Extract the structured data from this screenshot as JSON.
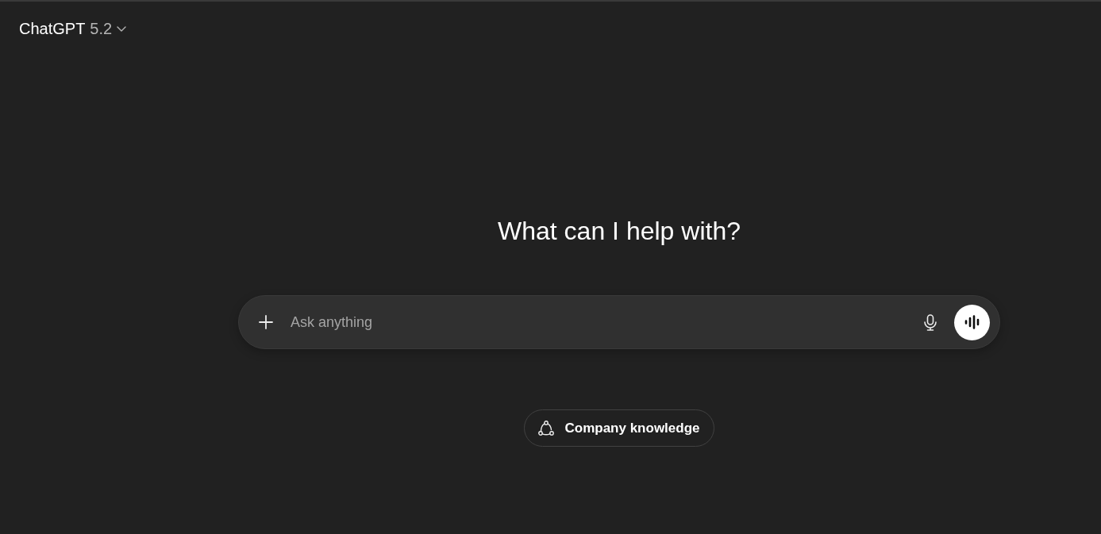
{
  "header": {
    "title": "ChatGPT",
    "version": "5.2"
  },
  "heading": "What can I help with?",
  "composer": {
    "placeholder": "Ask anything"
  },
  "tools": [
    {
      "label": "Company knowledge"
    }
  ]
}
